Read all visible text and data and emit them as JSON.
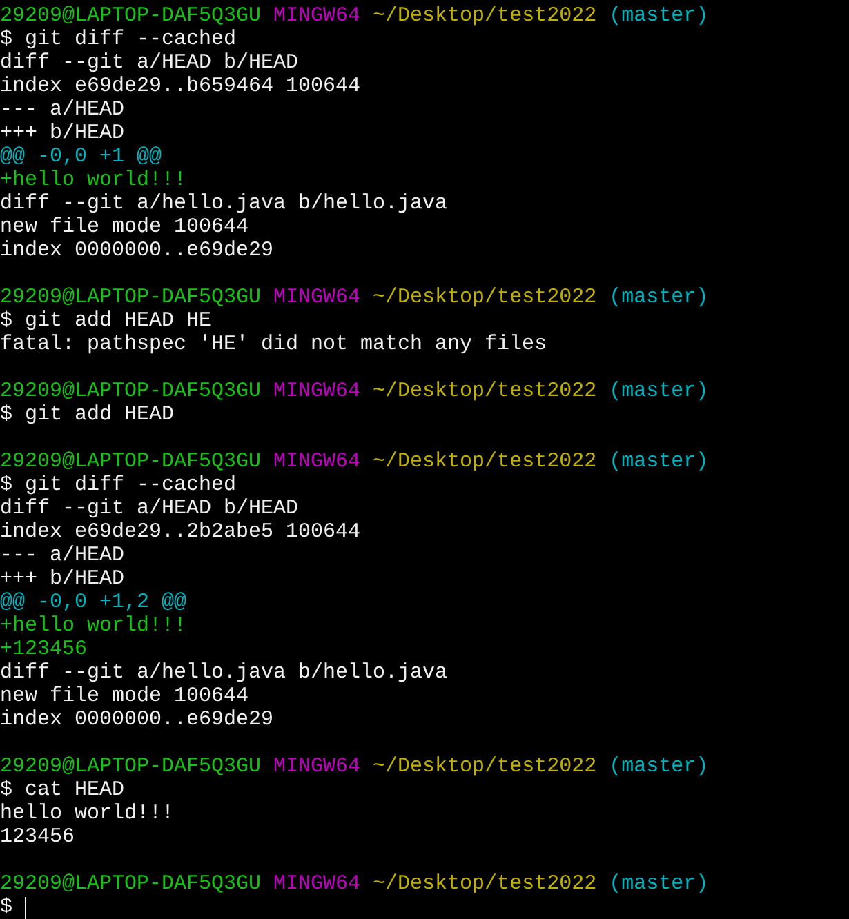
{
  "lines": [
    {
      "kind": "prompt",
      "user": "29209@LAPTOP-DAF5Q3GU",
      "shell": "MINGW64",
      "path": "~/Desktop/test2022",
      "branch": "(master)"
    },
    {
      "kind": "text",
      "text": "$ git diff --cached"
    },
    {
      "kind": "text",
      "text": "diff --git a/HEAD b/HEAD"
    },
    {
      "kind": "text",
      "text": "index e69de29..b659464 100644"
    },
    {
      "kind": "text",
      "text": "--- a/HEAD"
    },
    {
      "kind": "text",
      "text": "+++ b/HEAD"
    },
    {
      "kind": "hunk",
      "text": "@@ -0,0 +1 @@"
    },
    {
      "kind": "added",
      "text": "+hello world!!!"
    },
    {
      "kind": "text",
      "text": "diff --git a/hello.java b/hello.java"
    },
    {
      "kind": "text",
      "text": "new file mode 100644"
    },
    {
      "kind": "text",
      "text": "index 0000000..e69de29"
    },
    {
      "kind": "blank"
    },
    {
      "kind": "prompt",
      "user": "29209@LAPTOP-DAF5Q3GU",
      "shell": "MINGW64",
      "path": "~/Desktop/test2022",
      "branch": "(master)"
    },
    {
      "kind": "text",
      "text": "$ git add HEAD HE"
    },
    {
      "kind": "text",
      "text": "fatal: pathspec 'HE' did not match any files"
    },
    {
      "kind": "blank"
    },
    {
      "kind": "prompt",
      "user": "29209@LAPTOP-DAF5Q3GU",
      "shell": "MINGW64",
      "path": "~/Desktop/test2022",
      "branch": "(master)"
    },
    {
      "kind": "text",
      "text": "$ git add HEAD"
    },
    {
      "kind": "blank"
    },
    {
      "kind": "prompt",
      "user": "29209@LAPTOP-DAF5Q3GU",
      "shell": "MINGW64",
      "path": "~/Desktop/test2022",
      "branch": "(master)"
    },
    {
      "kind": "text",
      "text": "$ git diff --cached"
    },
    {
      "kind": "text",
      "text": "diff --git a/HEAD b/HEAD"
    },
    {
      "kind": "text",
      "text": "index e69de29..2b2abe5 100644"
    },
    {
      "kind": "text",
      "text": "--- a/HEAD"
    },
    {
      "kind": "text",
      "text": "+++ b/HEAD"
    },
    {
      "kind": "hunk",
      "text": "@@ -0,0 +1,2 @@"
    },
    {
      "kind": "added",
      "text": "+hello world!!!"
    },
    {
      "kind": "added",
      "text": "+123456"
    },
    {
      "kind": "text",
      "text": "diff --git a/hello.java b/hello.java"
    },
    {
      "kind": "text",
      "text": "new file mode 100644"
    },
    {
      "kind": "text",
      "text": "index 0000000..e69de29"
    },
    {
      "kind": "blank"
    },
    {
      "kind": "prompt",
      "user": "29209@LAPTOP-DAF5Q3GU",
      "shell": "MINGW64",
      "path": "~/Desktop/test2022",
      "branch": "(master)"
    },
    {
      "kind": "text",
      "text": "$ cat HEAD"
    },
    {
      "kind": "text",
      "text": "hello world!!!"
    },
    {
      "kind": "text",
      "text": "123456"
    },
    {
      "kind": "blank"
    },
    {
      "kind": "prompt",
      "user": "29209@LAPTOP-DAF5Q3GU",
      "shell": "MINGW64",
      "path": "~/Desktop/test2022",
      "branch": "(master)"
    },
    {
      "kind": "cursor",
      "text": "$"
    }
  ]
}
